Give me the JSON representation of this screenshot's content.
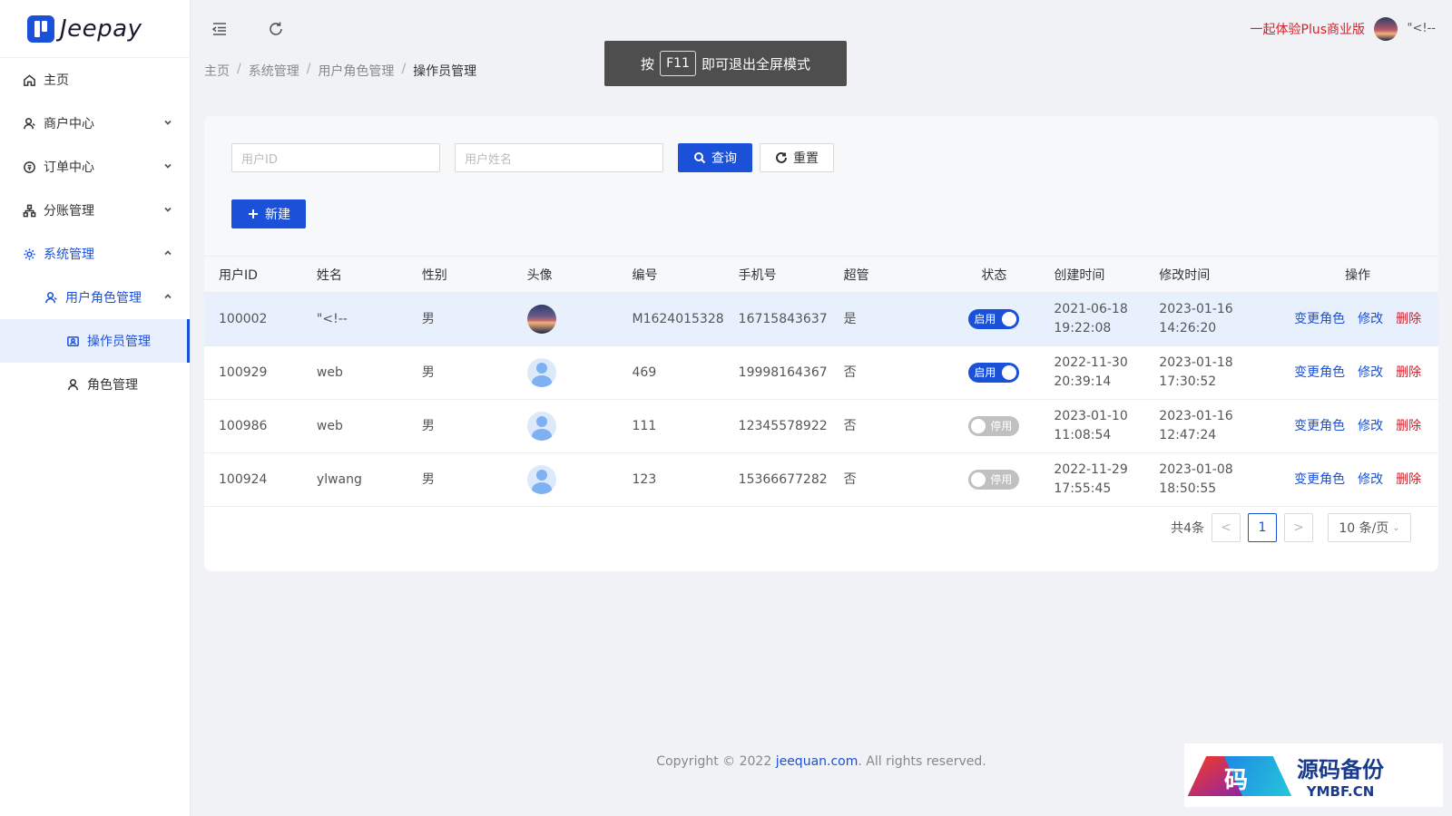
{
  "sidebar": {
    "logo_text": "Jeepay",
    "items": [
      {
        "label": "主页",
        "icon": "home-icon"
      },
      {
        "label": "商户中心",
        "icon": "merchant-icon"
      },
      {
        "label": "订单中心",
        "icon": "order-icon"
      },
      {
        "label": "分账管理",
        "icon": "split-icon"
      },
      {
        "label": "系统管理",
        "icon": "gear-icon"
      },
      {
        "label": "用户角色管理",
        "icon": "user-role-icon"
      },
      {
        "label": "操作员管理",
        "icon": "operator-icon"
      },
      {
        "label": "角色管理",
        "icon": "role-icon"
      }
    ]
  },
  "header": {
    "promo": "一起体验Plus商业版",
    "username": "\"<!--"
  },
  "breadcrumb": [
    "主页",
    "系统管理",
    "用户角色管理",
    "操作员管理"
  ],
  "toast": {
    "pre": "按",
    "key": "F11",
    "post": "即可退出全屏模式"
  },
  "search": {
    "user_id_placeholder": "用户ID",
    "user_name_placeholder": "用户姓名",
    "query_label": "查询",
    "reset_label": "重置",
    "new_label": "新建"
  },
  "table": {
    "columns": [
      "用户ID",
      "姓名",
      "性别",
      "头像",
      "编号",
      "手机号",
      "超管",
      "状态",
      "创建时间",
      "修改时间",
      "操作"
    ],
    "rows": [
      {
        "id": "100002",
        "name": "\"<!--",
        "gender": "男",
        "avatar": "photo",
        "code": "M1624015328",
        "phone": "16715843637",
        "admin": "是",
        "status": "启用",
        "status_on": true,
        "created_date": "2021-06-18",
        "created_time": "19:22:08",
        "modified_date": "2023-01-16",
        "modified_time": "14:26:20"
      },
      {
        "id": "100929",
        "name": "web",
        "gender": "男",
        "avatar": "default",
        "code": "469",
        "phone": "19998164367",
        "admin": "否",
        "status": "启用",
        "status_on": true,
        "created_date": "2022-11-30",
        "created_time": "20:39:14",
        "modified_date": "2023-01-18",
        "modified_time": "17:30:52"
      },
      {
        "id": "100986",
        "name": "web",
        "gender": "男",
        "avatar": "default",
        "code": "111",
        "phone": "12345578922",
        "admin": "否",
        "status": "停用",
        "status_on": false,
        "created_date": "2023-01-10",
        "created_time": "11:08:54",
        "modified_date": "2023-01-16",
        "modified_time": "12:47:24"
      },
      {
        "id": "100924",
        "name": "ylwang",
        "gender": "男",
        "avatar": "default",
        "code": "123",
        "phone": "15366677282",
        "admin": "否",
        "status": "停用",
        "status_on": false,
        "created_date": "2022-11-29",
        "created_time": "17:55:45",
        "modified_date": "2023-01-08",
        "modified_time": "18:50:55"
      }
    ],
    "actions": {
      "change_role": "变更角色",
      "edit": "修改",
      "delete": "删除"
    }
  },
  "pagination": {
    "total": "共4条",
    "prev": "<",
    "current": "1",
    "next": ">",
    "page_size": "10 条/页"
  },
  "footer": {
    "prefix": "Copyright © 2022 ",
    "link": "jeequan.com",
    "suffix": ". All rights reserved."
  },
  "watermark": {
    "glyph": "码",
    "title": "源码备份",
    "domain": "YMBF.CN"
  },
  "colors": {
    "primary": "#1b50d8",
    "danger": "#d4202c",
    "active_bg": "#e8f0fe"
  }
}
